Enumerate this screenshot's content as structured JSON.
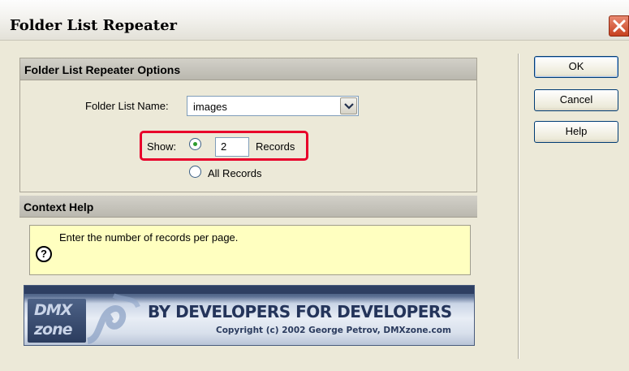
{
  "window": {
    "title": "Folder List Repeater"
  },
  "options": {
    "header": "Folder List Repeater Options",
    "folder_list_label": "Folder List Name:",
    "folder_list_value": "images",
    "show_label": "Show:",
    "records_value": "2",
    "records_label": "Records",
    "all_records_label": "All Records",
    "selected_option": "show-records"
  },
  "context_help": {
    "header": "Context Help",
    "text": "Enter the number of records per page.",
    "icon_glyph": "?"
  },
  "banner": {
    "logo_line1": "DMX",
    "logo_line2": "zone",
    "tagline": "BY DEVELOPERS FOR DEVELOPERS",
    "copyright": "Copyright (c) 2002 George Petrov, DMXzone.com"
  },
  "buttons": {
    "ok": "OK",
    "cancel": "Cancel",
    "help": "Help"
  },
  "colors": {
    "highlight": "#e8002a",
    "help_background": "#ffffc0",
    "radio_selected": "#2c9c2c"
  },
  "icons": {
    "close": "close-icon",
    "dropdown": "chevron-down-icon",
    "help": "question-mark-icon"
  }
}
